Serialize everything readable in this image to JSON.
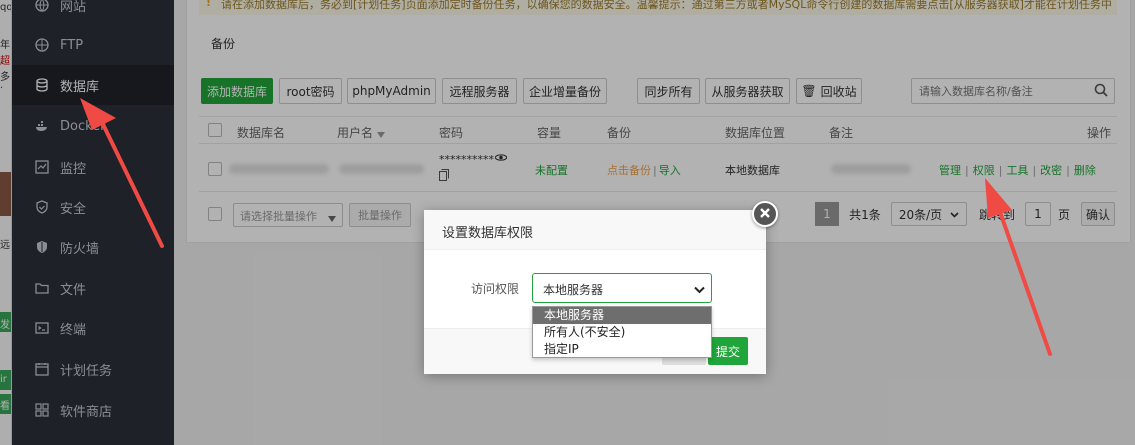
{
  "sidebar": {
    "items": [
      {
        "label": "网站",
        "icon": "globe-icon"
      },
      {
        "label": "FTP",
        "icon": "ftp-icon"
      },
      {
        "label": "数据库",
        "icon": "database-icon",
        "active": true
      },
      {
        "label": "Docker",
        "icon": "docker-icon"
      },
      {
        "label": "监控",
        "icon": "monitor-icon"
      },
      {
        "label": "安全",
        "icon": "shield-icon"
      },
      {
        "label": "防火墙",
        "icon": "firewall-icon"
      },
      {
        "label": "文件",
        "icon": "folder-icon"
      },
      {
        "label": "终端",
        "icon": "terminal-icon"
      },
      {
        "label": "计划任务",
        "icon": "clock-icon"
      },
      {
        "label": "软件商店",
        "icon": "grid-icon"
      }
    ]
  },
  "left_strip": {
    "fragments": [
      "qq",
      "年",
      "超",
      "多·",
      "远",
      "发",
      "ir",
      "看"
    ]
  },
  "warning_text": "请在添加数据库后，务必到[计划任务]页面添加定时备份任务，以确保您的数据安全。温馨提示：通过第三方或者MySQL命令行创建的数据库需要点击[从服务器获取]才能在计划任务中",
  "backup_label": "备份",
  "toolbar": {
    "add_db": "添加数据库",
    "root_pw": "root密码",
    "phpmyadmin": "phpMyAdmin",
    "remote": "远程服务器",
    "enterprise_backup": "企业增量备份",
    "sync_all": "同步所有",
    "fetch_server": "从服务器获取",
    "recycle": "回收站",
    "search_placeholder": "请输入数据库名称/备注"
  },
  "table": {
    "headers": [
      "数据库名",
      "用户名",
      "密码",
      "容量",
      "备份",
      "数据库位置",
      "备注",
      "操作"
    ],
    "row": {
      "password_mask": "**********",
      "capacity": "未配置",
      "backup_action": "点击备份",
      "import": "导入",
      "location": "本地数据库",
      "ops": [
        "管理",
        "权限",
        "工具",
        "改密",
        "删除"
      ]
    }
  },
  "footer": {
    "batch_placeholder": "请选择批量操作",
    "batch_btn": "批量操作",
    "page_current": "1",
    "total": "共1条",
    "per_page": "20条/页",
    "goto": "跳转到",
    "goto_value": "1",
    "page_unit": "页",
    "confirm": "确认"
  },
  "modal": {
    "title": "设置数据库权限",
    "access_label": "访问权限",
    "selected": "本地服务器",
    "options": [
      "本地服务器",
      "所有人(不安全)",
      "指定IP"
    ],
    "submit": "提交"
  },
  "colors": {
    "sidebar_bg": "#2c3038",
    "accent_green": "#20a53a",
    "arrow_red": "#f04a45"
  }
}
